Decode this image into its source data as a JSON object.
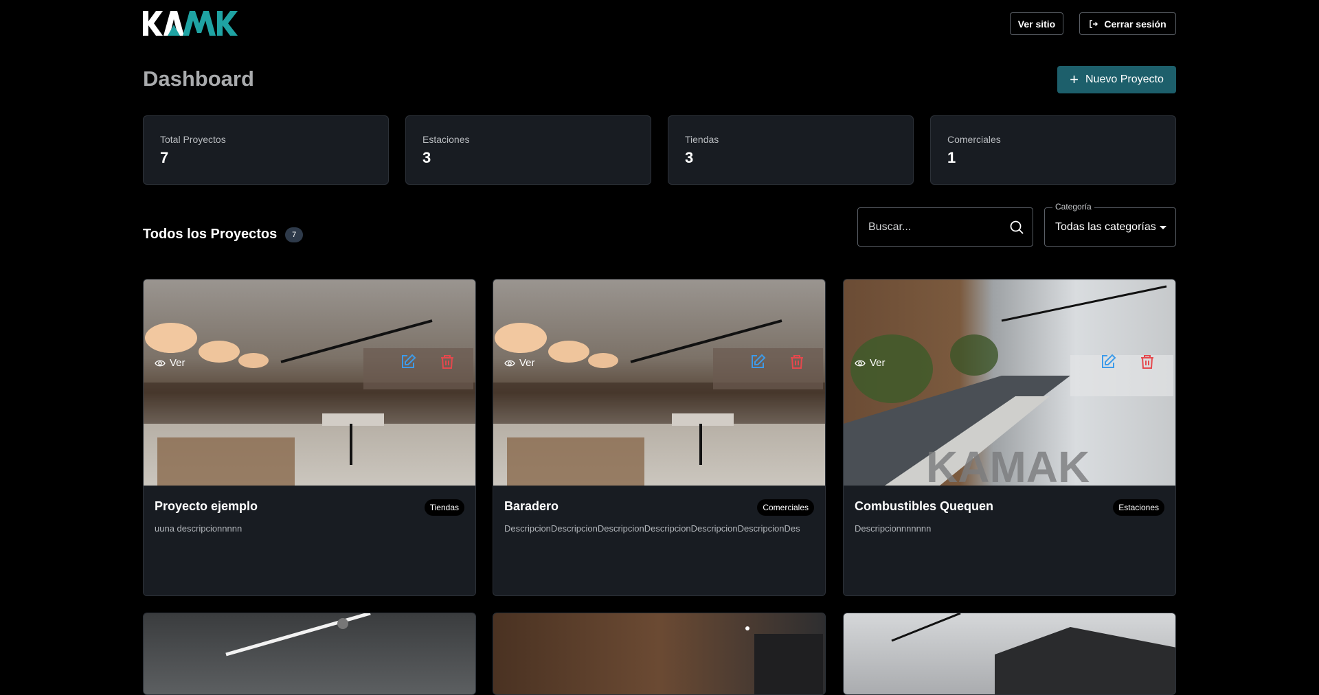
{
  "brand": {
    "logo_text": "KAMAK",
    "accent": "#1fa3a3"
  },
  "header": {
    "view_site": "Ver sitio",
    "logout": "Cerrar sesión"
  },
  "page": {
    "title": "Dashboard",
    "new_project": "Nuevo Proyecto"
  },
  "stats": [
    {
      "label": "Total Proyectos",
      "value": "7"
    },
    {
      "label": "Estaciones",
      "value": "3"
    },
    {
      "label": "Tiendas",
      "value": "3"
    },
    {
      "label": "Comerciales",
      "value": "1"
    }
  ],
  "projects_section": {
    "title": "Todos los Proyectos",
    "count": "7",
    "search_placeholder": "Buscar...",
    "category_label": "Categoría",
    "category_value": "Todas las categorías"
  },
  "projects": [
    {
      "title": "Proyecto ejemplo",
      "category": "Tiendas",
      "description": "uuna descripcionnnnn",
      "view_label": "Ver"
    },
    {
      "title": "Baradero",
      "category": "Comerciales",
      "description": "DescripcionDescripcionDescripcionDescripcionDescripcionDescripcionDes",
      "view_label": "Ver"
    },
    {
      "title": "Combustibles Quequen",
      "category": "Estaciones",
      "description": "Descripcionnnnnnn",
      "view_label": "Ver"
    }
  ],
  "colors": {
    "edit_icon": "#3d9be9",
    "delete_icon": "#e5484d",
    "primary_button": "#1d5f6b"
  }
}
